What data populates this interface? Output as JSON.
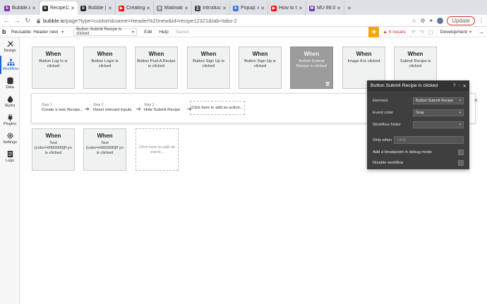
{
  "browser": {
    "tabs": [
      {
        "label": "Bubble.is Tuto",
        "favicon_color": "#7b2ea8",
        "favicon_char": "b"
      },
      {
        "label": "Recipe12321",
        "favicon_color": "#222222",
        "favicon_char": "b",
        "active": true
      },
      {
        "label": "Bubble | No-c",
        "favicon_color": "#222222",
        "favicon_char": "b"
      },
      {
        "label": "Creating a Po",
        "favicon_color": "#ff0000",
        "favicon_char": "▶"
      },
      {
        "label": "Mailinator",
        "favicon_color": "#888888",
        "favicon_char": "◎"
      },
      {
        "label": "Introducing th",
        "favicon_color": "#444444",
        "favicon_char": "▯"
      },
      {
        "label": "Popup: enter",
        "favicon_color": "#3a76d0",
        "favicon_char": "b"
      },
      {
        "label": "How to take a",
        "favicon_color": "#ff0000",
        "favicon_char": "▶"
      },
      {
        "label": "MU 89.03 - 1",
        "favicon_color": "#6b3fa0",
        "favicon_char": "M"
      }
    ],
    "new_tab": "+",
    "url_host": "bubble.io",
    "url_path": "/page?type=custom&name=Header%20new&id=recipe12321&tab=tabs-2",
    "update_label": "Update"
  },
  "editor": {
    "logo": "b",
    "reusable_label": "Reusable: Header new",
    "element_select": "Button Submit Recipe is clicked",
    "menu_edit": "Edit",
    "menu_help": "Help",
    "saved": "Saved",
    "issues": "6 issues",
    "environment": "Development"
  },
  "sidebar": {
    "items": [
      {
        "label": "Design",
        "icon": "design-icon"
      },
      {
        "label": "Workflow",
        "icon": "workflow-icon",
        "active": true
      },
      {
        "label": "Data",
        "icon": "database-icon"
      },
      {
        "label": "Styles",
        "icon": "styles-icon"
      },
      {
        "label": "Plugins",
        "icon": "plugins-icon"
      },
      {
        "label": "Settings",
        "icon": "gear-icon"
      },
      {
        "label": "Logs",
        "icon": "logs-icon"
      }
    ]
  },
  "workflow": {
    "when_label": "When",
    "events": [
      {
        "desc": "Button Log In is clicked"
      },
      {
        "desc": "Button Login is clicked"
      },
      {
        "desc": "Button Post A Recipe is clicked"
      },
      {
        "desc": "Button Sign Up is clicked"
      },
      {
        "desc": "Button Sign Up is clicked"
      },
      {
        "desc": "Button Submit Recipe is clicked",
        "selected": true
      },
      {
        "desc": "Image A is clicked"
      },
      {
        "desc": "Submit Recipe is clicked"
      },
      {
        "desc": "Text [color=#000000]If yo is clicked"
      },
      {
        "desc": "Text [color=#000000]If yo is clicked"
      }
    ],
    "add_event": "Click here to add an event...",
    "steps": [
      {
        "num": "Step 1",
        "title": "Create a new Recipe..."
      },
      {
        "num": "Step 2",
        "title": "Reset relevant inputs"
      },
      {
        "num": "Step 3",
        "title": "Hide Submit Recipe"
      }
    ],
    "add_action": "Click here to add an action..."
  },
  "panel": {
    "title": "Button Submit Recipe is clicked",
    "element_label": "Element",
    "element_value": "Button Submit Recipe",
    "color_label": "Event color",
    "color_value": "Gray",
    "folder_label": "Workflow folder",
    "folder_value": "",
    "only_when_label": "Only when",
    "only_when_placeholder": "Click",
    "breakpoint_label": "Add a breakpoint in debug mode",
    "disable_label": "Disable workflow"
  },
  "colors": {
    "accent": "#1b64d9",
    "selected_card": "#9c9c9c",
    "panel_bg": "#3f3f3f",
    "issues": "#d93025",
    "gift": "#f7a600"
  }
}
